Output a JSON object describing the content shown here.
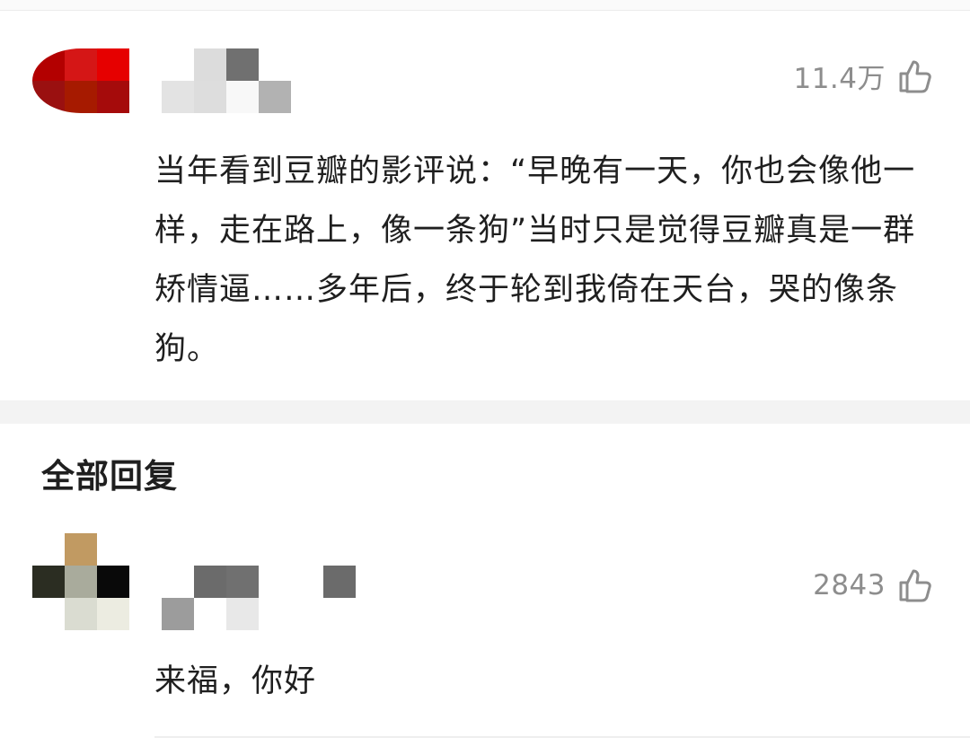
{
  "main_comment": {
    "likes": "11.4万",
    "text": "当年看到豆瓣的影评说：“早晚有一天，你也会像他一样，走在路上，像一条狗”当时只是觉得豆瓣真是一群矫情逼……多年后，终于轮到我倚在天台，哭的像条狗。",
    "avatar_colors": [
      "#b30000",
      "#d51616",
      "#e60000",
      "#9a1010",
      "#a61a00",
      "#a50b0b"
    ],
    "username_colors": [
      "#dcdcdc",
      "#707070",
      "#e3e3e3",
      "#dddddd",
      "#f8f8f8",
      "#b2b2b2"
    ]
  },
  "section": {
    "title": "全部回复"
  },
  "reply_comment": {
    "likes": "2843",
    "text": "来福，你好",
    "avatar_colors": [
      "#c19a62",
      "#2b2d22",
      "#a9ab9c",
      "#090909",
      "#dadcd1",
      "#ecece1"
    ],
    "username_colors": [
      "#6b6b6b",
      "#707070",
      "#9c9c9c",
      "#e8e8e8",
      "#767676"
    ]
  },
  "icons": {
    "like": "thumbs-up-icon"
  }
}
